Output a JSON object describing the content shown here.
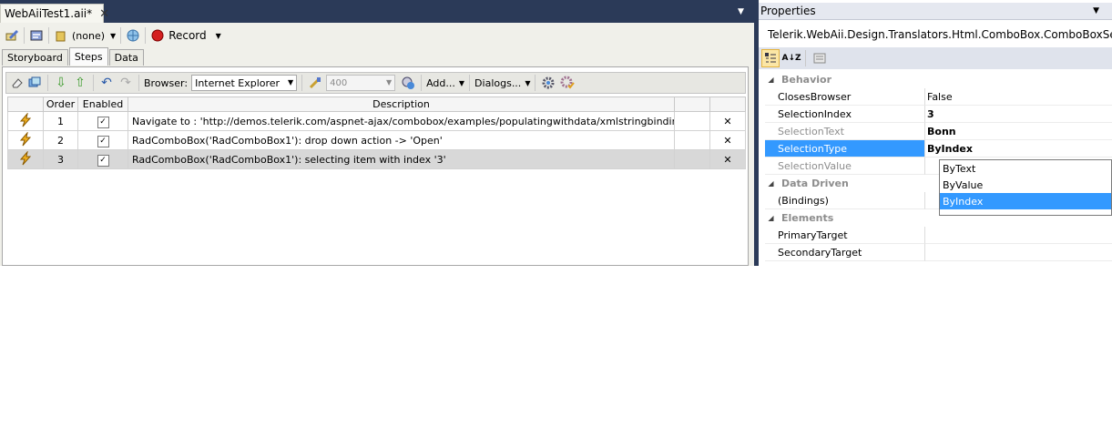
{
  "document": {
    "tab_title": "WebAiiTest1.aii*",
    "toolbar": {
      "none_label": "(none)",
      "record_label": "Record"
    },
    "tabs": [
      "Storyboard",
      "Steps",
      "Data"
    ],
    "steps_toolbar": {
      "browser_label": "Browser:",
      "browser_value": "Internet Explorer",
      "wait_value": "400",
      "add_label": "Add...",
      "dialogs_label": "Dialogs..."
    },
    "table": {
      "headers": [
        "Order",
        "Enabled",
        "Description"
      ],
      "rows": [
        {
          "order": "1",
          "description": "Navigate to : 'http://demos.telerik.com/aspnet-ajax/combobox/examples/populatingwithdata/xmlstringbinding/default..."
        },
        {
          "order": "2",
          "description": "RadComboBox('RadComboBox1'): drop down action -> 'Open'"
        },
        {
          "order": "3",
          "description": "RadComboBox('RadComboBox1'): selecting item with index '3'"
        }
      ]
    }
  },
  "properties": {
    "title": "Properties",
    "object_name": "Telerik.WebAii.Design.Translators.Html.ComboBox.ComboBoxSelection",
    "categories": {
      "behavior": "Behavior",
      "data_driven": "Data Driven",
      "elements": "Elements"
    },
    "rows": {
      "closes_browser": {
        "name": "ClosesBrowser",
        "value": "False"
      },
      "selection_index": {
        "name": "SelectionIndex",
        "value": "3"
      },
      "selection_text": {
        "name": "SelectionText",
        "value": "Bonn"
      },
      "selection_type": {
        "name": "SelectionType",
        "value": "ByIndex"
      },
      "selection_value": {
        "name": "SelectionValue",
        "value": ""
      },
      "bindings": {
        "name": "(Bindings)",
        "value": ""
      },
      "primary_target": {
        "name": "PrimaryTarget",
        "value": ""
      },
      "secondary_target": {
        "name": "SecondaryTarget",
        "value": ""
      }
    },
    "dropdown_options": [
      "ByText",
      "ByValue",
      "ByIndex"
    ]
  },
  "colors": {
    "frame": "#2b3a58",
    "selection_blue": "#3399ff",
    "record_red": "#d42020"
  }
}
